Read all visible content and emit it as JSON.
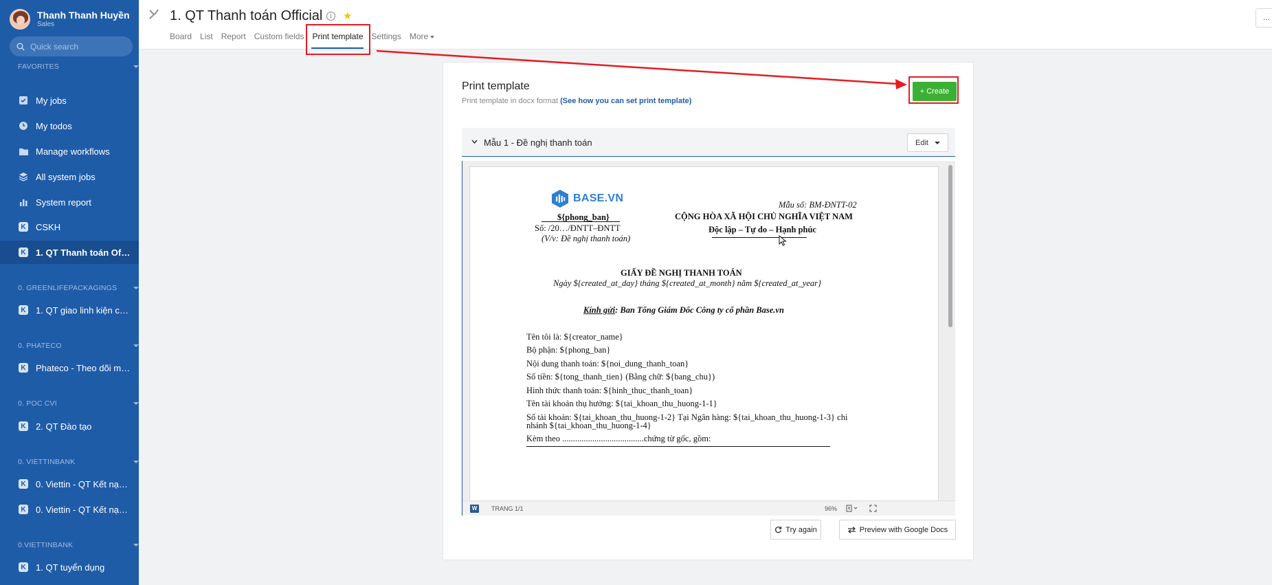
{
  "sidebar": {
    "user": {
      "name": "Thanh Thanh Huyền",
      "role": "Sales"
    },
    "search_placeholder": "Quick search",
    "sections": [
      {
        "label": "FAVORITES"
      },
      {
        "label": "0. GREENLIFEPACKAGINGS"
      },
      {
        "label": "0. PHATECO"
      },
      {
        "label": "0. POC CVI"
      },
      {
        "label": "0. VIETTINBANK"
      },
      {
        "label": "0.VIETTINBANK"
      }
    ],
    "items": [
      {
        "label": "My jobs",
        "icon": "check-square-icon"
      },
      {
        "label": "My todos",
        "icon": "clock-icon"
      },
      {
        "label": "Manage workflows",
        "icon": "folder-icon"
      },
      {
        "label": "All system jobs",
        "icon": "layers-icon"
      },
      {
        "label": "System report",
        "icon": "bar-chart-icon"
      },
      {
        "label": "CSKH",
        "icon": "workflow-k-icon"
      },
      {
        "label": "1. QT Thanh toán Official",
        "icon": "workflow-k-icon",
        "active": true
      },
      {
        "label": "1. QT giao linh kiện cho...",
        "icon": "workflow-k-icon"
      },
      {
        "label": "Phateco - Theo dõi mu...",
        "icon": "workflow-k-icon"
      },
      {
        "label": "2. QT Đào tạo",
        "icon": "workflow-k-icon"
      },
      {
        "label": "0. Viettin - QT Kết nạp ...",
        "icon": "workflow-k-icon"
      },
      {
        "label": "0. Viettin - QT Kết nạp ...",
        "icon": "workflow-k-icon"
      },
      {
        "label": "1. QT tuyển dụng",
        "icon": "workflow-k-icon"
      }
    ]
  },
  "header": {
    "title": "1. QT Thanh toán Official",
    "tabs": [
      "Board",
      "List",
      "Report",
      "Custom fields",
      "Print template",
      "Settings",
      "More"
    ],
    "active_tab": "Print template",
    "top_right": "..."
  },
  "card": {
    "title": "Print template",
    "subtitle": "Print template in docx format",
    "help_link": "(See how you can set print template)",
    "create_label": "+ Create",
    "template_name": "Mẫu 1 - Đề nghị thanh toán",
    "edit_label": "Edit",
    "try_again_label": "Try again",
    "preview_google_label": "Preview with Google Docs"
  },
  "doc": {
    "logo_text": "BASE.VN",
    "form_code": "Mẫu số: BM-ĐNTT-02",
    "dept": "${phong_ban}",
    "number_line": "Số:        /20…/ĐNTT–ĐNTT",
    "subject": "(V/v: Đề nghị thanh toán)",
    "nation": "CỘNG HÒA XÃ HỘI CHỦ NGHĨA VIỆT NAM",
    "motto": "Độc lập – Tự do – Hạnh phúc",
    "heading": "GIẤY ĐỀ NGHỊ THANH TOÁN",
    "date_line": "Ngày ${created_at_day} tháng ${created_at_month} năm ${created_at_year}",
    "greeting_label": "Kính gửi",
    "greeting_rest": ": Ban Tổng Giám Đốc Công ty cổ phần Base.vn",
    "lines": [
      "Tên tôi là: ${creator_name}",
      "Bộ phận: ${phong_ban}",
      "Nội dung thanh toán: ${noi_dung_thanh_toan}",
      "Số tiền: ${tong_thanh_tien} (Bằng chữ: ${bang_chu})",
      "Hình thức thanh toán: ${hinh_thuc_thanh_toan}",
      "Tên tài khoản thụ hưởng: ${tai_khoan_thu_huong-1-1}",
      "Số tài khoản: ${tai_khoan_thu_huong-1-2}  Tại Ngân hàng: ${tai_khoan_thu_huong-1-3} chi",
      "nhánh ${tai_khoan_thu_huong-1-4}",
      "Kèm theo ......................................chứng từ gốc, gồm:"
    ],
    "footer_page": "TRANG 1/1",
    "footer_zoom": "96%"
  },
  "colors": {
    "sidebar_bg": "#1f5ca8",
    "create_green": "#3cb034",
    "annotation_red": "#e51c23",
    "star": "#f3c10b"
  }
}
